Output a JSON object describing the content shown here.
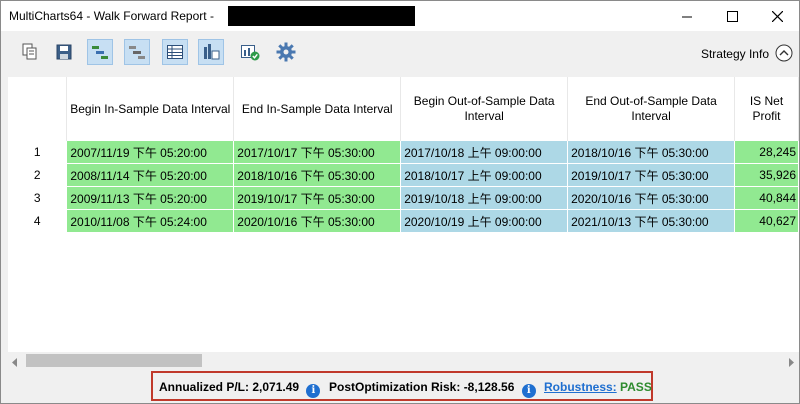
{
  "window": {
    "title": "MultiCharts64 - Walk Forward Report - "
  },
  "toolbar": {
    "buttons": [
      {
        "icon": "copy-icon",
        "active": false
      },
      {
        "icon": "save-icon",
        "active": false
      },
      {
        "icon": "gantt-color-icon",
        "active": true
      },
      {
        "icon": "gantt-gray-icon",
        "active": true
      },
      {
        "icon": "table-view-icon",
        "active": true
      },
      {
        "icon": "chart-calendar-icon",
        "active": true
      },
      {
        "icon": "chart-check-icon",
        "active": false
      },
      {
        "icon": "gear-icon",
        "active": false
      }
    ],
    "strategy_info_label": "Strategy Info"
  },
  "table": {
    "headers": [
      "",
      "Begin In-Sample Data Interval",
      "End In-Sample Data Interval",
      "Begin Out-of-Sample Data Interval",
      "End Out-of-Sample Data Interval",
      "IS Net Profit"
    ],
    "rows": [
      {
        "n": "1",
        "c1": "2007/11/19 下午 05:20:00",
        "c2": "2017/10/17 下午 05:30:00",
        "c3": "2017/10/18 上午 09:00:00",
        "c4": "2018/10/16 下午 05:30:00",
        "c5": "28,245"
      },
      {
        "n": "2",
        "c1": "2008/11/14 下午 05:20:00",
        "c2": "2018/10/16 下午 05:30:00",
        "c3": "2018/10/17 上午 09:00:00",
        "c4": "2019/10/17 下午 05:30:00",
        "c5": "35,926"
      },
      {
        "n": "3",
        "c1": "2009/11/13 下午 05:20:00",
        "c2": "2019/10/17 下午 05:30:00",
        "c3": "2019/10/18 上午 09:00:00",
        "c4": "2020/10/16 下午 05:30:00",
        "c5": "40,844"
      },
      {
        "n": "4",
        "c1": "2010/11/08 下午 05:24:00",
        "c2": "2020/10/16 下午 05:30:00",
        "c3": "2020/10/19 上午 09:00:00",
        "c4": "2021/10/13 下午 05:30:00",
        "c5": "40,627"
      }
    ]
  },
  "status": {
    "annualized_label": "Annualized P/L:",
    "annualized_value": "2,071.49",
    "post_label": "PostOptimization Risk:",
    "post_value": "-8,128.56",
    "robustness_label": "Robustness:",
    "robustness_value": "PASS",
    "info_glyph": "i"
  },
  "colors": {
    "in_sample": "#91e991",
    "out_sample": "#add8e6",
    "highlight_border": "#c0392b"
  }
}
